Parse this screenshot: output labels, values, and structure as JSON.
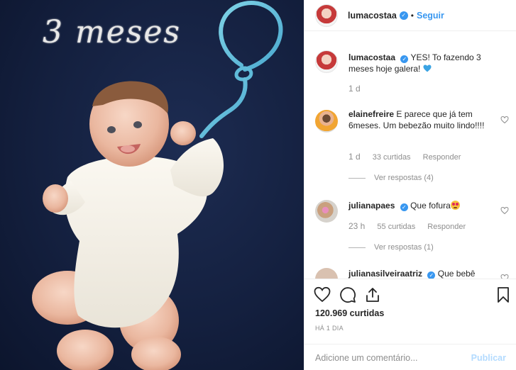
{
  "photo": {
    "overlay_text": "3 meses"
  },
  "header": {
    "username": "lumacostaa",
    "separator": "•",
    "follow_label": "Seguir"
  },
  "comments": [
    {
      "username": "lumacostaa",
      "text": "YES! To fazendo 3 meses hoje galera! ",
      "age": "1 d"
    },
    {
      "username": "elainefreire",
      "text": "E parece que já tem 6meses. Um bebezão muito lindo!!!!",
      "age": "1 d",
      "likes": "33 curtidas",
      "reply_label": "Responder",
      "view_replies": "Ver respostas (4)"
    },
    {
      "username": "julianapaes",
      "text": "Que fofura",
      "age": "23 h",
      "likes": "55 curtidas",
      "reply_label": "Responder",
      "view_replies": "Ver respostas (1)"
    },
    {
      "username": "julianasilveiraatriz",
      "text": "Que bebê"
    }
  ],
  "post": {
    "likes": "120.969 curtidas",
    "age": "HÁ 1 DIA",
    "comment_placeholder": "Adicione um comentário...",
    "publish_label": "Publicar"
  },
  "icons": {
    "like": "heart-icon",
    "comment": "comment-bubble-icon",
    "share": "share-icon",
    "save": "bookmark-icon",
    "verified": "verified-badge-icon"
  },
  "colors": {
    "accent": "#3897f0",
    "publish_disabled": "#b3dbff",
    "muted": "#8e8e8e",
    "photo_background": "#14203f"
  }
}
